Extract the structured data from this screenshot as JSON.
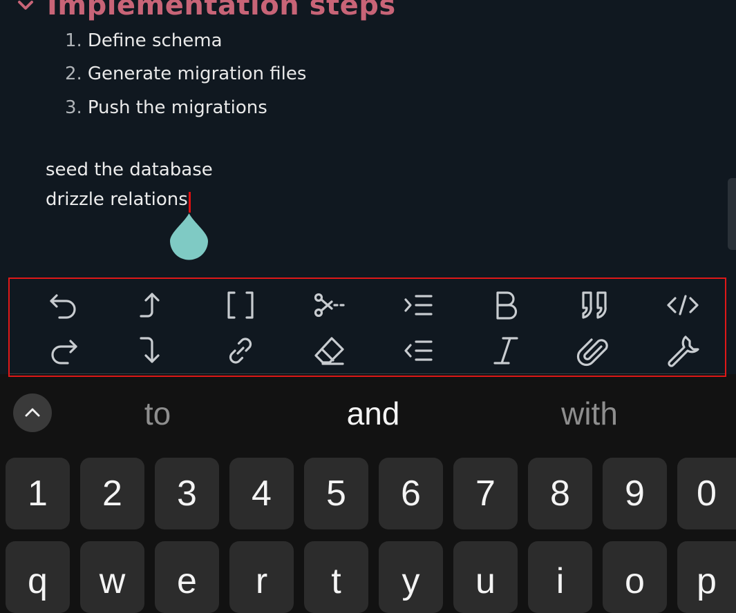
{
  "editor": {
    "heading": "Implementation steps",
    "steps": [
      {
        "num": "1.",
        "text": "Define schema"
      },
      {
        "num": "2.",
        "text": "Generate migration files"
      },
      {
        "num": "3.",
        "text": "Push the migrations"
      }
    ],
    "paragraphs": [
      "seed the database",
      "drizzle relations"
    ]
  },
  "toolbar": {
    "buttons": [
      {
        "name": "undo-icon"
      },
      {
        "name": "move-up-icon"
      },
      {
        "name": "checkbox-brackets-icon"
      },
      {
        "name": "cut-icon"
      },
      {
        "name": "indent-icon"
      },
      {
        "name": "bold-icon"
      },
      {
        "name": "quote-icon"
      },
      {
        "name": "code-icon"
      },
      {
        "name": "redo-icon"
      },
      {
        "name": "move-down-icon"
      },
      {
        "name": "link-icon"
      },
      {
        "name": "eraser-icon"
      },
      {
        "name": "outdent-icon"
      },
      {
        "name": "italic-icon"
      },
      {
        "name": "attachment-icon"
      },
      {
        "name": "wrench-icon"
      }
    ]
  },
  "keyboard": {
    "suggestions": [
      "to",
      "and",
      "with"
    ],
    "number_row": [
      "1",
      "2",
      "3",
      "4",
      "5",
      "6",
      "7",
      "8",
      "9",
      "0"
    ],
    "top_row": [
      "q",
      "w",
      "e",
      "r",
      "t",
      "y",
      "u",
      "i",
      "o",
      "p"
    ]
  },
  "colors": {
    "editor_bg": "#101820",
    "heading": "#c86477",
    "cursor": "#e01010",
    "cursor_handle": "#7fcac4",
    "keyboard_bg": "#121212",
    "key_bg": "#2c2c2c"
  }
}
